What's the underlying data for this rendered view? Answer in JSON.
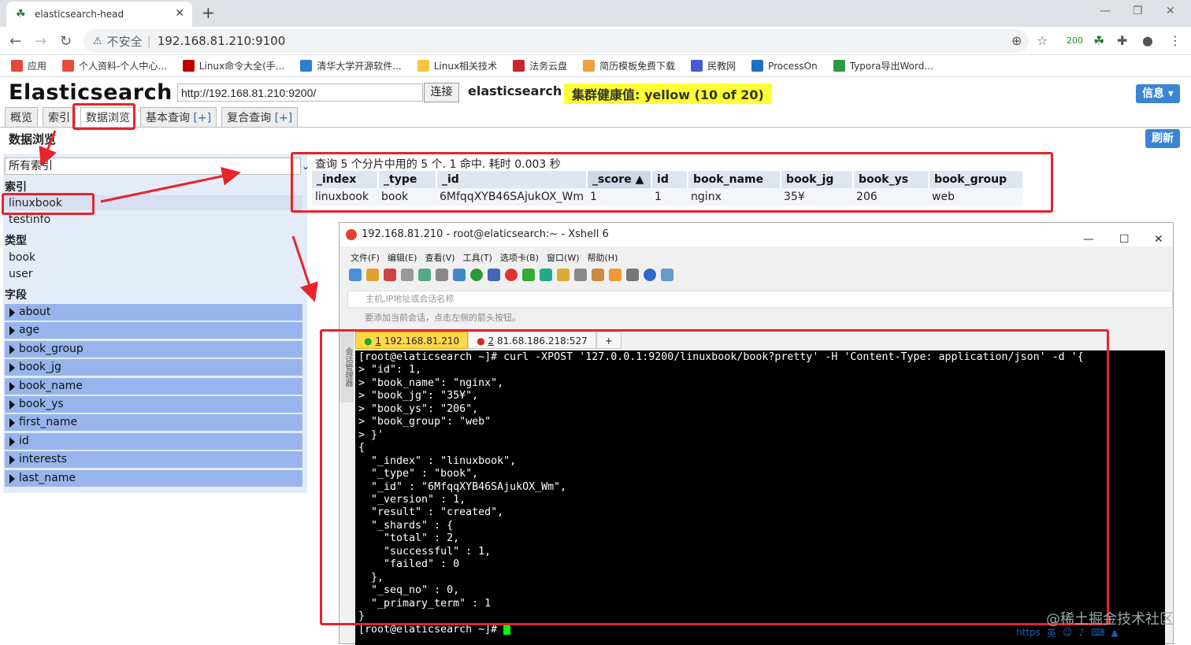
{
  "browser": {
    "tab_title": "elasticsearch-head",
    "insecure_label": "不安全",
    "url": "192.168.81.210:9100",
    "ext_badge": "200",
    "bookmarks": [
      {
        "label": "应用",
        "color": "#e04b3a"
      },
      {
        "label": "个人资料-个人中心...",
        "color": "#e84c3d"
      },
      {
        "label": "Linux命令大全(手...",
        "color": "#c00000"
      },
      {
        "label": "清华大学开源软件...",
        "color": "#2f7cd3"
      },
      {
        "label": "Linux相关技术",
        "color": "#f5c542"
      },
      {
        "label": "法务云盘",
        "color": "#c8252c"
      },
      {
        "label": "简历模板免费下载",
        "color": "#e8a33d"
      },
      {
        "label": "民教网",
        "color": "#4a5ad0"
      },
      {
        "label": "ProcessOn",
        "color": "#1f6fc6"
      },
      {
        "label": "Typora导出Word...",
        "color": "#2e9a45"
      }
    ]
  },
  "es": {
    "title": "Elasticsearch",
    "cluster_url": "http://192.168.81.210:9200/",
    "connect_label": "连接",
    "cluster_name": "elasticsearch",
    "health": "集群健康值: yellow (10 of 20)",
    "info_label": "信息 ▾",
    "refresh_label": "刷新",
    "tabs": [
      {
        "label": "概览",
        "plus": ""
      },
      {
        "label": "索引",
        "plus": ""
      },
      {
        "label": "数据浏览",
        "plus": ""
      },
      {
        "label": "基本查询 ",
        "plus": "[+]"
      },
      {
        "label": "复合查询 ",
        "plus": "[+]"
      }
    ],
    "section_title": "数据浏览",
    "index_select": "所有索引",
    "index_header": "索引",
    "indices": [
      "linuxbook",
      "testinfo"
    ],
    "type_header": "类型",
    "types": [
      "book",
      "user"
    ],
    "field_header": "字段",
    "fields": [
      "about",
      "age",
      "book_group",
      "book_jg",
      "book_name",
      "book_ys",
      "first_name",
      "id",
      "interests",
      "last_name"
    ]
  },
  "results": {
    "summary": "查询 5 个分片中用的 5 个. 1 命中. 耗时 0.003 秒",
    "columns": [
      "_index",
      "_type",
      "_id",
      "_score ▲",
      "id",
      "book_name",
      "book_jg",
      "book_ys",
      "book_group"
    ],
    "rows": [
      [
        "linuxbook",
        "book",
        "6MfqqXYB46SAjukOX_Wm",
        "1",
        "1",
        "nginx",
        "35¥",
        "206",
        "web"
      ]
    ]
  },
  "xshell": {
    "title": "192.168.81.210 - root@elaticsearch:~ - Xshell 6",
    "menu": [
      "文件(F)",
      "编辑(E)",
      "查看(V)",
      "工具(T)",
      "选项卡(B)",
      "窗口(W)",
      "帮助(H)"
    ],
    "host_placeholder": "主机,IP地址或会话名称",
    "tip": "要添加当前会话，点击左侧的箭头按钮。",
    "side_label": "会话管理器",
    "tabs": [
      {
        "num": "1",
        "label": " 192.168.81.210"
      },
      {
        "num": "2",
        "label": " 81.68.186.218:527"
      }
    ],
    "terminal": "[root@elaticsearch ~]# curl -XPOST '127.0.0.1:9200/linuxbook/book?pretty' -H 'Content-Type: application/json' -d '{\n> \"id\": 1,\n> \"book_name\": \"nginx\",\n> \"book_jg\": \"35¥\",\n> \"book_ys\": \"206\",\n> \"book_group\": \"web\"\n> }'\n{\n  \"_index\" : \"linuxbook\",\n  \"_type\" : \"book\",\n  \"_id\" : \"6MfqqXYB46SAjukOX_Wm\",\n  \"_version\" : 1,\n  \"result\" : \"created\",\n  \"_shards\" : {\n    \"total\" : 2,\n    \"successful\" : 1,\n    \"failed\" : 0\n  },\n  \"_seq_no\" : 0,\n  \"_primary_term\" : 1\n}",
    "prompt": "[root@elaticsearch ~]# "
  },
  "overlay": {
    "watermark": "@稀土掘金技术社区",
    "tray_url": "https",
    "tray_ime": "英"
  }
}
